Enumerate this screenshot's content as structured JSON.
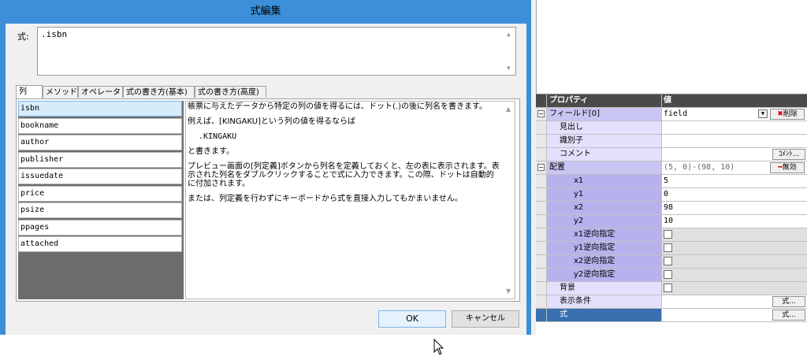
{
  "dialog": {
    "title": "式編集",
    "expr_label": "式:",
    "expr_value": ".isbn",
    "tabs": [
      "列",
      "メソッド",
      "オペレータ",
      "式の書き方(基本)",
      "式の書き方(高度)"
    ],
    "columns": [
      "isbn",
      "bookname",
      "author",
      "publisher",
      "issuedate",
      "price",
      "psize",
      "ppages",
      "attached"
    ],
    "help": {
      "p1": "帳票に与えたデータから特定の列の値を得るには、ドット(.)の後に列名を書きます。",
      "p2": "例えば、[KINGAKU]という列の値を得るならば",
      "code": ".KINGAKU",
      "p3": "と書きます。",
      "p4": "プレビュー画面の[列定義]ボタンから列名を定義しておくと、左の表に表示されます。表示された列名をダブルクリックすることで式に入力できます。この際、ドットは自動的に付加されます。",
      "p5": "または、列定義を行わずにキーボードから式を直接入力してもかまいません。"
    },
    "ok_label": "OK",
    "cancel_label": "キャンセル"
  },
  "props": {
    "header_name": "プロパティ",
    "header_value": "値",
    "field_name": "フィールド[0]",
    "field_value": "field",
    "delete_label": "削除",
    "heading": "見出し",
    "identifier": "識別子",
    "comment": "コメント",
    "comment_btn": "ｺﾒﾝﾄ...",
    "layout": "配置",
    "layout_value": "(5, 0)-(98, 10)",
    "disable_label": "無効",
    "x1": "x1",
    "x1_value": "5",
    "y1": "y1",
    "y1_value": "0",
    "x2": "x2",
    "x2_value": "98",
    "y2": "y2",
    "y2_value": "10",
    "x1rev": "x1逆向指定",
    "y1rev": "y1逆向指定",
    "x2rev": "x2逆向指定",
    "y2rev": "y2逆向指定",
    "background": "背景",
    "display_cond": "表示条件",
    "expr": "式",
    "expr_btn": "式...",
    "cond_btn": "式..."
  }
}
